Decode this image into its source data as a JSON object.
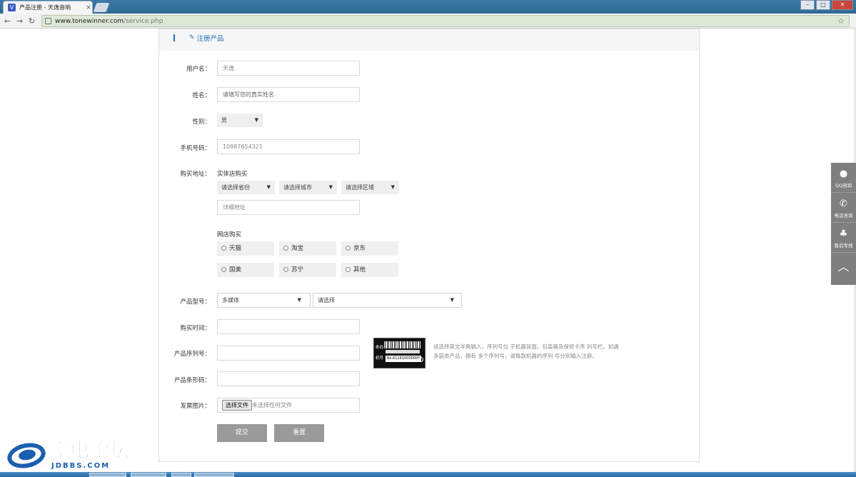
{
  "browser": {
    "tab_title": "产品注册 - 天逸音响",
    "tab_close": "×",
    "url_host": "www.tonewinner.com",
    "url_path": "/service.php"
  },
  "header": {
    "title": "注册产品"
  },
  "form": {
    "username": {
      "label": "用户名：",
      "value": "天逸"
    },
    "name": {
      "label": "姓名：",
      "placeholder": "请填写您的真实姓名"
    },
    "gender": {
      "label": "性别：",
      "value": "男"
    },
    "phone": {
      "label": "手机号码：",
      "value": "10987654321"
    },
    "purchase": {
      "label": "购买地址：",
      "store_title": "实体店购买",
      "province": "请选择省份",
      "city": "请选择城市",
      "district": "请选择区域",
      "address_placeholder": "详细地址",
      "online_title": "网店购买",
      "online_options": [
        "天猫",
        "淘宝",
        "京东",
        "国美",
        "苏宁",
        "其他"
      ]
    },
    "model": {
      "label": "产品型号：",
      "category": "多媒体",
      "model": "请选择"
    },
    "purchase_time": {
      "label": "购买时间："
    },
    "serial": {
      "label": "产品序列号：",
      "image_label_1": "条码",
      "image_label_2": "机号",
      "image_no": "No.611610000009",
      "hint": "请选择英文半角输入，序列号位 于机器背面，包装箱及保修卡序 列号栏。如遇多装类产品，拥有 多个序列号，请每款机器的序列 号分别输入注册。"
    },
    "barcode": {
      "label": "产品条形码："
    },
    "invoice": {
      "label": "发票图片：",
      "button": "选择文件",
      "filename": "未选择任何文件"
    },
    "submit": "提交",
    "reset": "重置"
  },
  "sidebar": {
    "qq": "QQ咨询",
    "phone": "电话咨询",
    "aftersale": "售后专线"
  },
  "watermark": {
    "name": "家电论坛",
    "domain": "JDBBS.COM"
  }
}
